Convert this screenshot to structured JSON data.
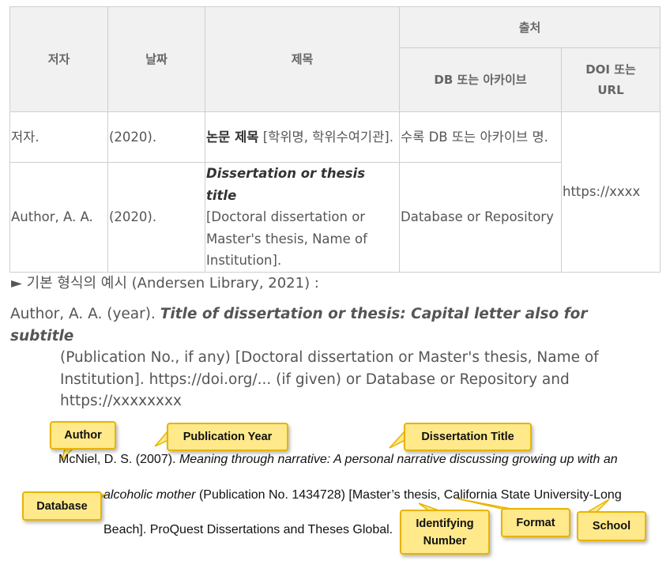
{
  "table": {
    "headers": {
      "author": "저자",
      "date": "날짜",
      "title": "제목",
      "source": "출처",
      "db": "DB 또는 아카이브",
      "doi_line1": "DOI 또는",
      "doi_line2": "URL"
    },
    "rows": [
      {
        "author": "저자.",
        "date": "(2020).",
        "title_main": "논문 제목",
        "title_rest": " [학위명, 학위수여기관].",
        "db": "수록 DB 또는 아카이브 명."
      },
      {
        "author": "Author, A. A.",
        "date": "(2020).",
        "title_main": "Dissertation or thesis title",
        "title_rest": "[Doctoral dissertation or Master's thesis, Name of Institution].",
        "db": "Database or Repository"
      }
    ],
    "doi_value": "https://xxxx"
  },
  "example_heading": "► 기본 형식의 예시 (Andersen Library, 2021) :",
  "reference": {
    "prefix": "Author, A. A. (year). ",
    "title": "Title of dissertation or thesis: Capital letter also for subtitle",
    "rest": "(Publication No., if any) [Doctoral dissertation or Master's thesis, Name of Institution]. https://doi.org/... (if given) or Database or Repository and https://xxxxxxxx"
  },
  "example": {
    "line1_plain": "McNiel, D. S. (2007). ",
    "line1_italic": "Meaning through narrative: A personal narrative discussing growing up with an",
    "line2_italic": "alcoholic mother",
    "line2_plain": " (Publication No. 1434728) [Master’s thesis, California State University-Long",
    "line3": "Beach]. ProQuest Dissertations and Theses Global."
  },
  "callouts": {
    "author": "Author",
    "publication_year": "Publication Year",
    "dissertation_title": "Dissertation Title",
    "database": "Database",
    "identifying_line1": "Identifying",
    "identifying_line2": "Number",
    "format": "Format",
    "school": "School"
  },
  "colors": {
    "callout_fill": "#ffe98a",
    "callout_border": "#e7b400",
    "header_bg": "#f1f1f1"
  }
}
